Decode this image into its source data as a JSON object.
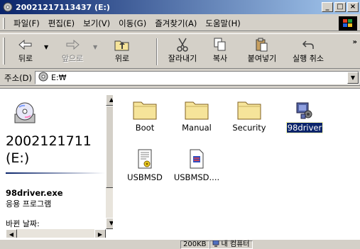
{
  "window": {
    "title": "20021217113437 (E:)"
  },
  "title_buttons": {
    "minimize": "_",
    "maximize": "□",
    "close": "×"
  },
  "menu": [
    {
      "label": "파일(F)"
    },
    {
      "label": "편집(E)"
    },
    {
      "label": "보기(V)"
    },
    {
      "label": "이동(G)"
    },
    {
      "label": "즐겨찾기(A)"
    },
    {
      "label": "도움말(H)"
    }
  ],
  "toolbar": {
    "back": "뒤로",
    "forward": "앞으로",
    "up": "위로",
    "cut": "잘라내기",
    "copy": "복사",
    "paste": "붙여넣기",
    "undo": "실행 취소",
    "more": "»"
  },
  "address": {
    "label": "주소(D)",
    "value": "E:₩"
  },
  "left_pane": {
    "drive_name": "2002121711",
    "drive_letter": "(E:)",
    "selected_file": "98driver.exe",
    "selected_type": "응용 프로그램",
    "modified_label": "바뀐 날짜:"
  },
  "files": [
    {
      "name": "Boot",
      "icon": "folder-icon",
      "selected": false
    },
    {
      "name": "Manual",
      "icon": "folder-icon",
      "selected": false
    },
    {
      "name": "Security",
      "icon": "folder-icon",
      "selected": false
    },
    {
      "name": "98driver",
      "icon": "setup-program-icon",
      "selected": true
    },
    {
      "name": "USBMSD",
      "icon": "setup-info-icon",
      "selected": false
    },
    {
      "name": "USBMSD....",
      "icon": "installer-icon",
      "selected": false
    }
  ],
  "status": {
    "size": "200KB",
    "location": "내 컴퓨터"
  },
  "colors": {
    "title_start": "#0a246a",
    "title_end": "#a6caf0",
    "selection": "#0a246a",
    "folder": "#f6e49a"
  }
}
